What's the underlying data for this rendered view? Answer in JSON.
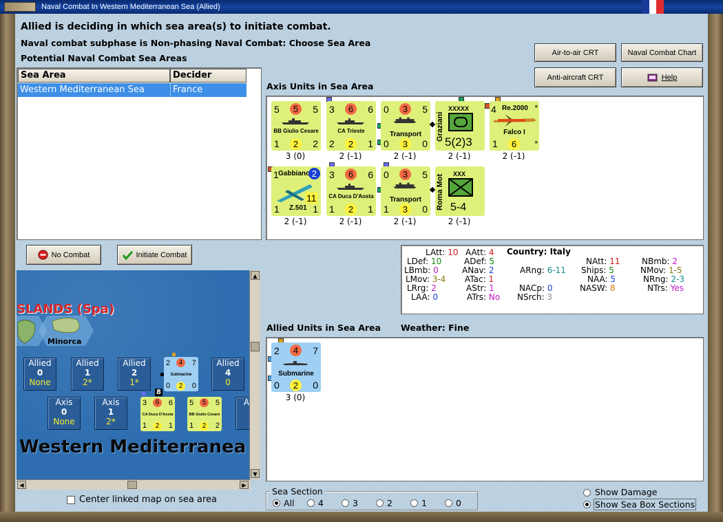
{
  "window": {
    "title": "Naval Combat In Western Mediterranean Sea (Allied)"
  },
  "header": {
    "line1": "Allied is deciding in which sea area(s) to initiate combat.",
    "line2": "Naval combat subphase is Non-phasing Naval Combat: Choose Sea Area",
    "line3": "Potential Naval Combat Sea Areas"
  },
  "buttons": {
    "air_to_air": "Air-to-air CRT",
    "naval_chart": "Naval Combat Chart",
    "anti_aircraft": "Anti-aircraft CRT",
    "help": "Help",
    "no_combat": "No Combat",
    "initiate": "Initiate Combat"
  },
  "table": {
    "headers": [
      "Sea Area",
      "Decider"
    ],
    "rows": [
      {
        "area": "Western Mediterranean Sea",
        "decider": "France"
      }
    ]
  },
  "axis_section": {
    "label": "Axis Units in Sea Area"
  },
  "axis_units": [
    {
      "name": "BB Giulio Cesare",
      "tl": "5",
      "tc": "5",
      "tr": "5",
      "bl": "1",
      "bc": "2",
      "br": "2",
      "caption": "3 (0)"
    },
    {
      "name": "CA Trieste",
      "tl": "3",
      "tc": "6",
      "tr": "6",
      "bl": "2",
      "bc": "2",
      "br": "1",
      "caption": "2 (-1)"
    },
    {
      "name": "Transport",
      "tl": "0",
      "tc": "3",
      "tr": "5",
      "bl": "0",
      "bc": "3",
      "br": "0",
      "caption": "2 (-1)"
    },
    {
      "name": "Graziani",
      "type": "XXXXX",
      "value": "5(2)3",
      "caption": "2 (-1)"
    },
    {
      "name": "Falco I",
      "model": "Re.2000",
      "tl": "4",
      "bl": "1",
      "bc": "6",
      "star": "*",
      "caption": "2 (-1)"
    },
    {
      "name": "Z.501",
      "model": "Gabbiano",
      "tl": "1",
      "tr": "2",
      "bl": "1",
      "bc": "11",
      "br": "1",
      "caption": "2 (-1)"
    },
    {
      "name": "CA Duca D'Aosta",
      "tl": "3",
      "tc": "6",
      "tr": "6",
      "bl": "1",
      "bc": "2",
      "br": "1",
      "caption": "2 (-1)"
    },
    {
      "name": "Transport",
      "tl": "0",
      "tc": "3",
      "tr": "5",
      "bl": "1",
      "bc": "3",
      "br": "0",
      "caption": "2 (-1)"
    },
    {
      "name": "Roma Mot",
      "type": "XXX",
      "value": "5-4",
      "caption": "2 (-1)"
    }
  ],
  "stats": {
    "country_label": "Country:",
    "country": "Italy",
    "latt_l": "LAtt:",
    "latt": "10",
    "ldef_l": "LDef:",
    "ldef": "10",
    "lbmb_l": "LBmb:",
    "lbmb": "0",
    "lmov_l": "LMov:",
    "lmov": "3-4",
    "lrrg_l": "LRrg:",
    "lrrg": "2",
    "laa_l": "LAA:",
    "laa": "0",
    "aatt_l": "AAtt:",
    "aatt": "4",
    "adef_l": "ADef:",
    "adef": "5",
    "anav_l": "ANav:",
    "anav": "2",
    "atac_l": "ATac:",
    "atac": "1",
    "astr_l": "AStr:",
    "astr": "1",
    "atrs_l": "ATrs:",
    "atrs": "No",
    "arng_l": "ARng:",
    "arng": "6-11",
    "nacp_l": "NACp:",
    "nacp": "0",
    "nsrch_l": "NSrch:",
    "nsrch": "3",
    "natt_l": "NAtt:",
    "natt": "11",
    "ships_l": "Ships:",
    "ships": "5",
    "naa_l": "NAA:",
    "naa": "5",
    "nasw_l": "NASW:",
    "nasw": "8",
    "nbmb_l": "NBmb:",
    "nbmb": "2",
    "nmov_l": "NMov:",
    "nmov": "1-5",
    "nrng_l": "NRng:",
    "nrng": "2-3",
    "ntrs_l": "NTrs:",
    "ntrs": "Yes"
  },
  "allied_section": {
    "label": "Allied Units in Sea Area",
    "weather_label": "Weather:",
    "weather": "Fine"
  },
  "allied_units": [
    {
      "name": "Submarine",
      "tl": "2",
      "tc": "4",
      "tr": "7",
      "bl": "0",
      "bc": "2",
      "br": "0",
      "caption": "3 (0)"
    }
  ],
  "map": {
    "region_label": "SLANDS (Spa)",
    "island": "Minorca",
    "sea_label": "Western Mediterranea",
    "allied_boxes": [
      {
        "name": "Allied",
        "value": "0",
        "flag": "None"
      },
      {
        "name": "Allied",
        "value": "1",
        "flag": "2*"
      },
      {
        "name": "Allied",
        "value": "2",
        "flag": "1*"
      },
      {
        "name": "Allied",
        "value": "4",
        "flag": "0"
      }
    ],
    "axis_boxes": [
      {
        "name": "Axis",
        "value": "0",
        "flag": "None"
      },
      {
        "name": "Axis",
        "value": "1",
        "flag": "2*"
      }
    ],
    "sub_counter": {
      "tl": "2",
      "tc": "4",
      "tr": "7",
      "bl": "0",
      "bc": "2",
      "br": "0",
      "name": "Submarine"
    },
    "stack_count": "8",
    "ca_counter": {
      "tl": "3",
      "tc": "6",
      "tr": "6",
      "bl": "1",
      "bc": "2",
      "br": "1",
      "name": "CA Duca D'Aosta"
    },
    "bb_counter": {
      "tl": "5",
      "tc": "5",
      "tr": "5",
      "bl": "1",
      "bc": "2",
      "br": "2",
      "name": "BB Giulio Cesare"
    },
    "axis_partial": "A"
  },
  "center_map": {
    "label": "Center linked map on sea area",
    "checked": false
  },
  "sea_section": {
    "label": "Sea Section",
    "options": [
      "All",
      "4",
      "3",
      "2",
      "1",
      "0"
    ],
    "selected": "All"
  },
  "show_damage": {
    "label": "Show Damage",
    "checked": false
  },
  "show_sea_box": {
    "label": "Show Sea Box Sections",
    "checked": true
  },
  "colors": {
    "red": "#d11a1a",
    "green": "#108a10",
    "blue": "#1a3fd6",
    "magenta": "#c218c2",
    "olive": "#8a7a0a",
    "teal": "#128a8a",
    "orange": "#d87a10",
    "gray": "#888888"
  }
}
